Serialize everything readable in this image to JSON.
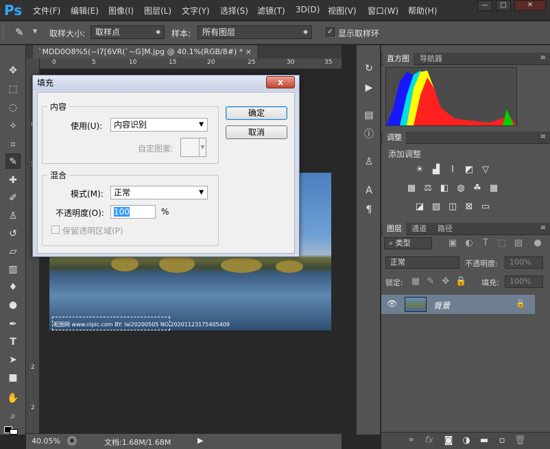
{
  "app": {
    "logo": "Ps"
  },
  "menu": [
    "文件(F)",
    "编辑(E)",
    "图像(I)",
    "图层(L)",
    "文字(Y)",
    "选择(S)",
    "滤镜(T)",
    "3D(D)",
    "视图(V)",
    "窗口(W)",
    "帮助(H)"
  ],
  "window_controls": {
    "minimize": "—",
    "maximize": "□",
    "close": "✕"
  },
  "options": {
    "sample_size_label": "取样大小:",
    "sample_size_value": "取样点",
    "sample_label": "样本:",
    "sample_value": "所有图层",
    "show_ring_label": "显示取样环",
    "show_ring_checked": true
  },
  "document": {
    "tab_title": "`MDD0O8%5(~I7[6VR(`~G]M.jpg @ 40.1%(RGB/8#) *",
    "tab_close": "×",
    "zoom": "40.05%",
    "doc_info": "文档:1.68M/1.68M",
    "ruler_h": [
      "0",
      "5",
      "10",
      "15",
      "20",
      "25",
      "30",
      "35"
    ],
    "ruler_v": [
      "0",
      "5",
      "1",
      "1",
      "2",
      "2"
    ],
    "watermark": "昵图网 www.nipic.com  BY: lai20200505   NO.20201123175405409"
  },
  "panels": {
    "histogram_tabs": [
      "直方图",
      "导航器"
    ],
    "adjustments_tab": "调整",
    "adjustments_add": "添加调整",
    "layers_tabs": [
      "图层",
      "通道",
      "路径"
    ],
    "kind_filter": "类型",
    "blend_mode": "正常",
    "opacity_label": "不透明度:",
    "opacity_value": "100%",
    "lock_label": "锁定:",
    "fill_label": "填充:",
    "fill_value": "100%",
    "layer_name": "背景"
  },
  "dialog": {
    "title": "填充",
    "close_label": "x",
    "content_group": "内容",
    "use_label": "使用(U):",
    "use_value": "内容识别",
    "custom_pattern_label": "自定图案:",
    "ok": "确定",
    "cancel": "取消",
    "blend_group": "混合",
    "mode_label": "模式(M):",
    "mode_value": "正常",
    "opacity_label": "不透明度(O):",
    "opacity_value": "100",
    "percent": "%",
    "preserve_label": "保留透明区域(P)"
  },
  "colors": {
    "accent": "#31a8ff",
    "layer_selected": "#6f7f92"
  }
}
